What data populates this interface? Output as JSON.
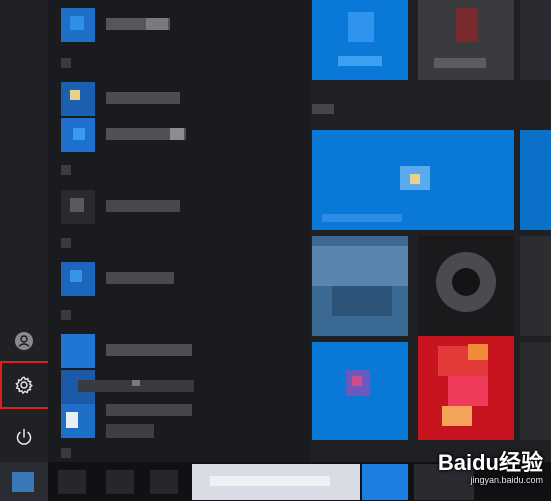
{
  "rail": {
    "account_icon": "user-avatar-icon",
    "settings_icon": "gear-icon",
    "power_icon": "power-icon",
    "highlight_color": "#e02020"
  },
  "watermark": {
    "logo": "Baidu经验",
    "url": "jingyan.baidu.com"
  },
  "colors": {
    "accent_blue": "#0a78d7",
    "tile_red": "#c8141e",
    "background": "#1c1d21"
  }
}
